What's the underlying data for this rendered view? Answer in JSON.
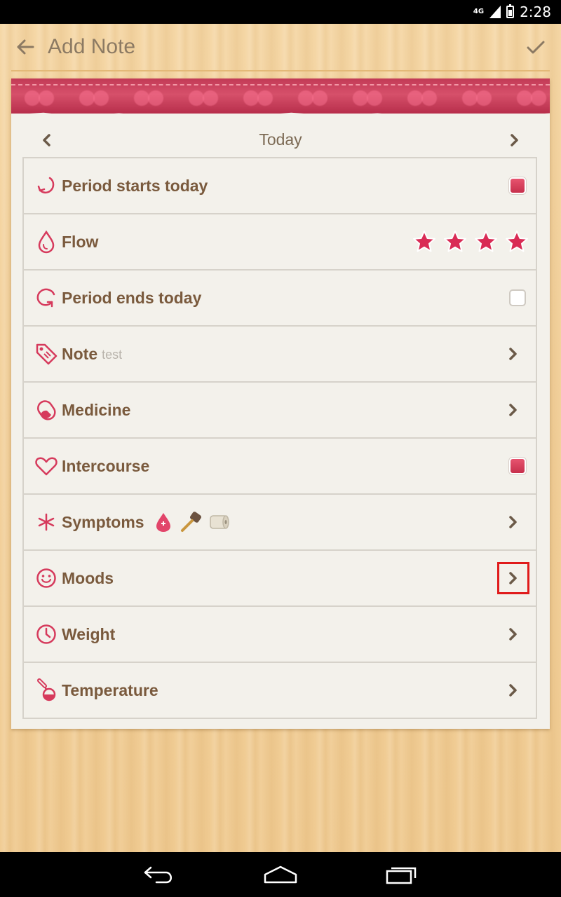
{
  "status_bar": {
    "network": "4G",
    "time": "2:28"
  },
  "app_bar": {
    "title": "Add Note",
    "back_icon": "arrow-left-icon",
    "done_icon": "checkmark-icon"
  },
  "date_nav": {
    "label": "Today"
  },
  "rows": [
    {
      "label": "Period starts today",
      "icon": "period-start-icon",
      "control": "checkbox",
      "checked": true
    },
    {
      "label": "Flow",
      "icon": "drop-icon",
      "control": "stars",
      "rating": 4
    },
    {
      "label": "Period ends today",
      "icon": "period-end-icon",
      "control": "checkbox",
      "checked": false
    },
    {
      "label": "Note",
      "sub": "test",
      "icon": "tag-icon",
      "control": "chevron"
    },
    {
      "label": "Medicine",
      "icon": "pill-icon",
      "control": "chevron"
    },
    {
      "label": "Intercourse",
      "icon": "heart-icon",
      "control": "checkbox",
      "checked": true
    },
    {
      "label": "Symptoms",
      "icon": "asterisk-icon",
      "control": "chevron",
      "symptoms": [
        "blood-drop-icon",
        "hammer-icon",
        "toilet-paper-icon"
      ]
    },
    {
      "label": "Moods",
      "icon": "smiley-icon",
      "control": "chevron",
      "focused": true
    },
    {
      "label": "Weight",
      "icon": "clock-icon",
      "control": "chevron"
    },
    {
      "label": "Temperature",
      "icon": "thermometer-icon",
      "control": "chevron"
    }
  ],
  "colors": {
    "accent": "#d63a5c",
    "label": "#7a5a3d",
    "wood": "#f2d09b",
    "card": "#f3f1eb"
  },
  "nav_bar": {
    "back_icon": "back-icon",
    "home_icon": "home-icon",
    "recents_icon": "recents-icon"
  }
}
